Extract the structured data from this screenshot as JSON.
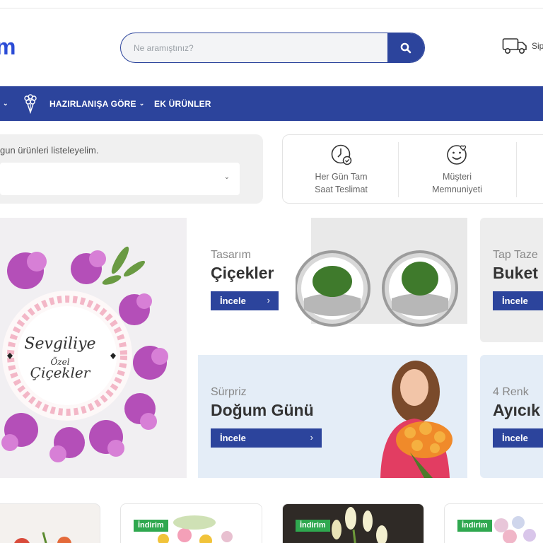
{
  "header": {
    "logo_text": "m",
    "search_placeholder": "Ne aramıştınız?",
    "ship_label": "Sip"
  },
  "nav": {
    "items": [
      {
        "label": "HAZIRLANIŞA GÖRE",
        "has_dropdown": true
      },
      {
        "label": "EK ÜRÜNLER",
        "has_dropdown": false
      }
    ]
  },
  "filter": {
    "text": "gun ürünleri listeleyelim."
  },
  "features": [
    {
      "line1": "Her Gün Tam",
      "line2": "Saat Teslimat",
      "icon": "clock-check-icon"
    },
    {
      "line1": "Müşteri",
      "line2": "Memnuniyeti",
      "icon": "smiley-heart-icon"
    }
  ],
  "hero": {
    "script_line1": "Sevgiliye",
    "script_line2": "Özel",
    "script_line3": "Çiçekler"
  },
  "banners": [
    {
      "sub": "Tasarım",
      "title": "Çiçekler",
      "button": "İncele"
    },
    {
      "sub": "Tap Taze",
      "title": "Buket",
      "button": "İncele"
    },
    {
      "sub": "Sürpriz",
      "title": "Doğum Günü",
      "button": "İncele"
    },
    {
      "sub": "4 Renk",
      "title": "Ayıcık",
      "button": "İncele"
    }
  ],
  "products": {
    "badge": "İndirim"
  },
  "colors": {
    "brand": "#2c449c",
    "badge": "#2fa84f",
    "logo": "#2a4bd6"
  }
}
